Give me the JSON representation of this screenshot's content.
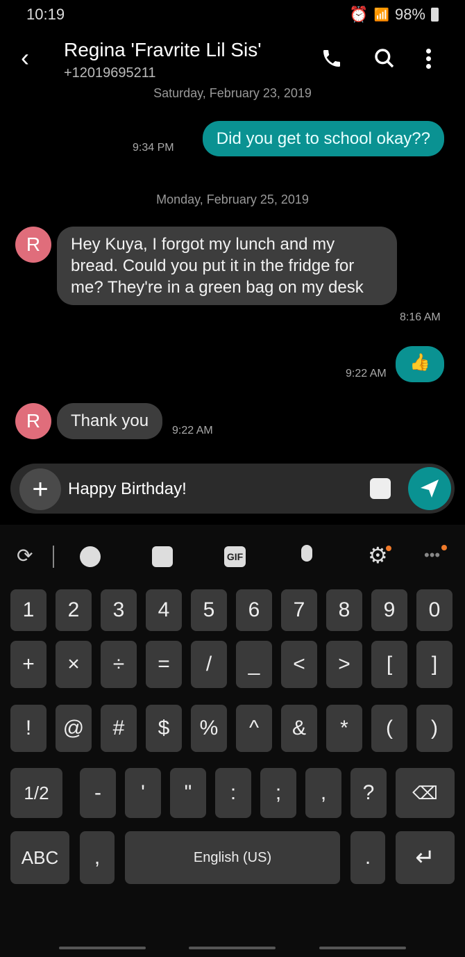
{
  "status": {
    "time": "10:19",
    "battery": "98%",
    "icons": [
      "alarm-icon",
      "wifi-icon",
      "signal-icon",
      "battery-icon"
    ]
  },
  "header": {
    "title": "Regina 'Fravrite Lil Sis'",
    "phone": "+12019695211"
  },
  "messages": [
    {
      "type": "date",
      "text": "Saturday, February 23, 2019"
    },
    {
      "type": "out",
      "text": "Did you get to school okay??",
      "time": "9:34 PM"
    },
    {
      "type": "date",
      "text": "Monday, February 25, 2019"
    },
    {
      "type": "in",
      "avatar": "R",
      "text": "Hey Kuya, I forgot my lunch and my bread. Could you put it in the fridge for me? They're in a green bag on my desk",
      "time": "8:16 AM"
    },
    {
      "type": "out",
      "text": "👍",
      "time": "9:22 AM"
    },
    {
      "type": "in",
      "avatar": "R",
      "text": "Thank you",
      "time": "9:22 AM"
    }
  ],
  "composer": {
    "value": "Happy Birthday!"
  },
  "toolbar": {
    "gif": "GIF"
  },
  "keyboard": {
    "row1": [
      "1",
      "2",
      "3",
      "4",
      "5",
      "6",
      "7",
      "8",
      "9",
      "0"
    ],
    "row2": [
      "+",
      "×",
      "÷",
      "=",
      "/",
      "_",
      "<",
      ">",
      "[",
      "]"
    ],
    "row3": [
      "!",
      "@",
      "#",
      "$",
      "%",
      "^",
      "&",
      "*",
      "(",
      ")"
    ],
    "row4": [
      "1/2",
      "-",
      "'",
      "\"",
      ":",
      ";",
      ",",
      "?"
    ],
    "row5": {
      "abc": "ABC",
      "comma": ",",
      "space": "English (US)",
      "period": "."
    }
  },
  "colors": {
    "accent": "#0a9292",
    "avatar": "#e06d7b",
    "notify": "#f07a2a"
  }
}
